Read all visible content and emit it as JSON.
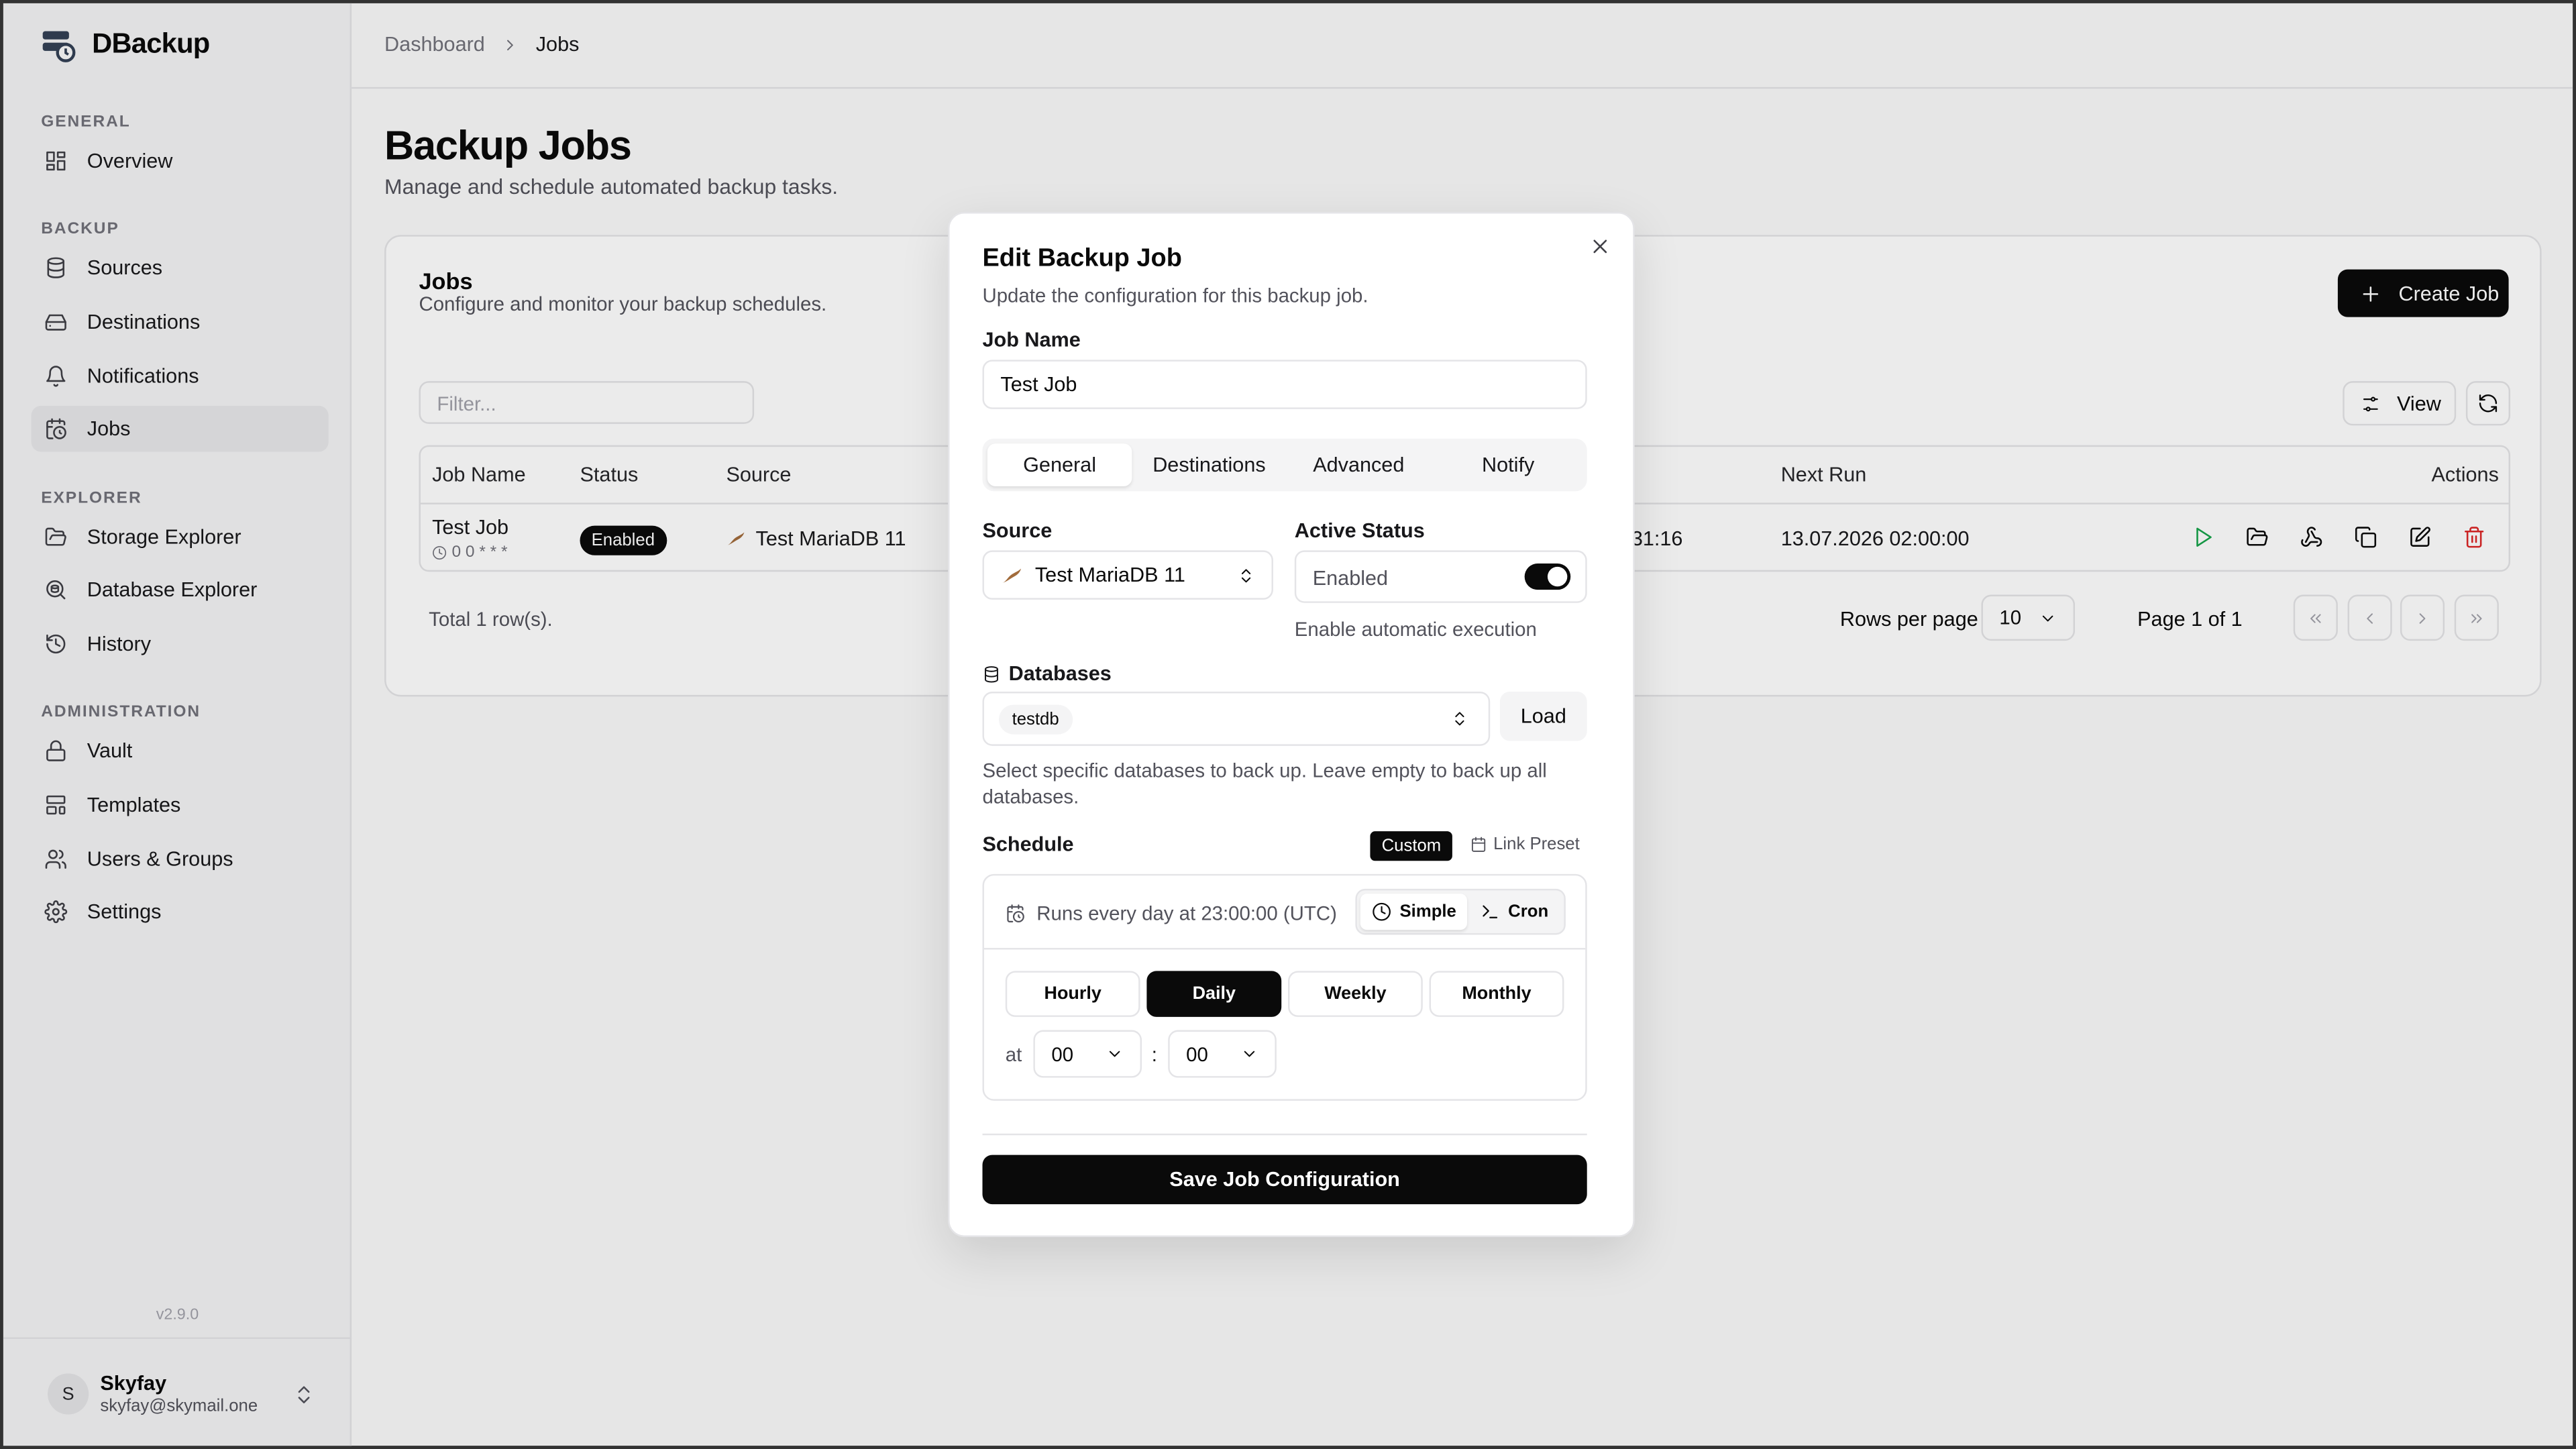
{
  "app": {
    "name": "DBackup",
    "version": "v2.9.0"
  },
  "breadcrumb": {
    "parent": "Dashboard",
    "current": "Jobs"
  },
  "sidebar": {
    "sections": {
      "general": "GENERAL",
      "backup": "BACKUP",
      "explorer": "EXPLORER",
      "administration": "ADMINISTRATION"
    },
    "items": {
      "overview": "Overview",
      "sources": "Sources",
      "destinations": "Destinations",
      "notifications": "Notifications",
      "jobs": "Jobs",
      "storage_explorer": "Storage Explorer",
      "database_explorer": "Database Explorer",
      "history": "History",
      "vault": "Vault",
      "templates": "Templates",
      "users_groups": "Users & Groups",
      "settings": "Settings"
    },
    "user": {
      "initial": "S",
      "name": "Skyfay",
      "email": "skyfay@skymail.one"
    }
  },
  "page": {
    "title": "Backup Jobs",
    "subtitle": "Manage and schedule automated backup tasks."
  },
  "jobs_card": {
    "title": "Jobs",
    "subtitle": "Configure and monitor your backup schedules.",
    "create_label": "Create Job",
    "filter_placeholder": "Filter...",
    "view_label": "View",
    "columns": {
      "job_name": "Job Name",
      "status": "Status",
      "source": "Source",
      "next_run": "Next Run",
      "actions": "Actions"
    },
    "row": {
      "name": "Test Job",
      "cron": "0 0 * * *",
      "status": "Enabled",
      "source": "Test MariaDB 11",
      "last_run_partial": "31:16",
      "next_run": "13.07.2026 02:00:00"
    },
    "total": "Total 1 row(s).",
    "rows_per_page_label": "Rows per page",
    "rows_per_page": "10",
    "page_info": "Page 1 of 1"
  },
  "modal": {
    "title": "Edit Backup Job",
    "subtitle": "Update the configuration for this backup job.",
    "job_name_label": "Job Name",
    "job_name_value": "Test Job",
    "tabs": [
      "General",
      "Destinations",
      "Advanced",
      "Notify"
    ],
    "source_label": "Source",
    "source_value": "Test MariaDB 11",
    "active_status_label": "Active Status",
    "active_status_value": "Enabled",
    "active_status_enabled": true,
    "active_status_hint": "Enable automatic execution",
    "databases_label": "Databases",
    "databases_selected": "testdb",
    "load_label": "Load",
    "databases_hint": "Select specific databases to back up. Leave empty to back up all databases.",
    "schedule_label": "Schedule",
    "schedule_custom": "Custom",
    "schedule_link_preset": "Link Preset",
    "schedule_description": "Runs every day at 23:00:00 (UTC)",
    "mode_simple": "Simple",
    "mode_cron": "Cron",
    "frequencies": [
      "Hourly",
      "Daily",
      "Weekly",
      "Monthly"
    ],
    "frequency_selected": "Daily",
    "at_label": "at",
    "hour": "00",
    "minute": "00",
    "colon": ":",
    "save_label": "Save Job Configuration"
  }
}
